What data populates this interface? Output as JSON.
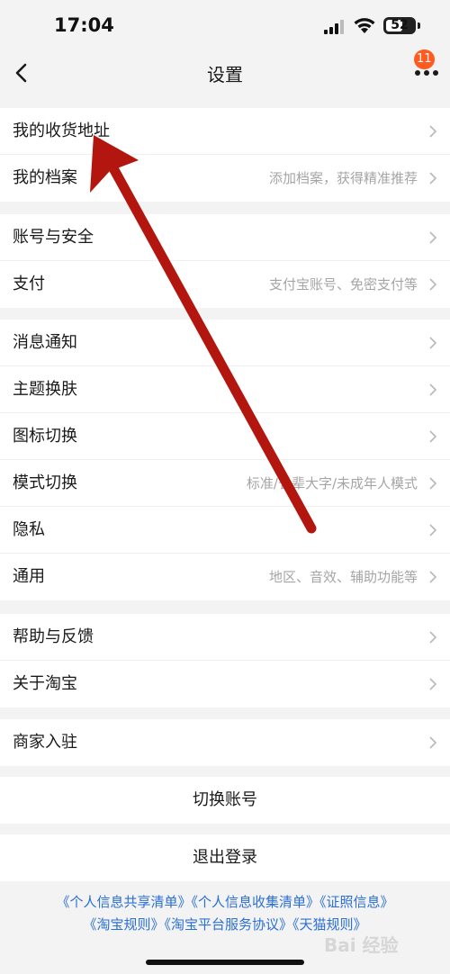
{
  "status_bar": {
    "time": "17:04",
    "battery": "52"
  },
  "nav": {
    "title": "设置",
    "badge": "11"
  },
  "groups": [
    {
      "items": [
        {
          "label": "我的收货地址",
          "hint": ""
        },
        {
          "label": "我的档案",
          "hint": "添加档案，获得精准推荐"
        }
      ]
    },
    {
      "items": [
        {
          "label": "账号与安全",
          "hint": ""
        },
        {
          "label": "支付",
          "hint": "支付宝账号、免密支付等"
        }
      ]
    },
    {
      "items": [
        {
          "label": "消息通知",
          "hint": ""
        },
        {
          "label": "主题换肤",
          "hint": ""
        },
        {
          "label": "图标切换",
          "hint": ""
        },
        {
          "label": "模式切换",
          "hint": "标准/长辈大字/未成年人模式"
        },
        {
          "label": "隐私",
          "hint": ""
        },
        {
          "label": "通用",
          "hint": "地区、音效、辅助功能等"
        }
      ]
    },
    {
      "items": [
        {
          "label": "帮助与反馈",
          "hint": ""
        },
        {
          "label": "关于淘宝",
          "hint": ""
        }
      ]
    },
    {
      "items": [
        {
          "label": "商家入驻",
          "hint": ""
        }
      ]
    }
  ],
  "actions": {
    "switch_account": "切换账号",
    "logout": "退出登录"
  },
  "footer": {
    "line1": [
      "《个人信息共享清单》",
      "《个人信息收集清单》",
      "《证照信息》"
    ],
    "line2": [
      "《淘宝规则》",
      "《淘宝平台服务协议》",
      "《天猫规则》"
    ]
  },
  "watermark": {
    "text": "Bai 经验"
  },
  "colors": {
    "accent": "#ff5a1f",
    "link": "#2a6fd6",
    "annotation_arrow": "#b3160f"
  }
}
